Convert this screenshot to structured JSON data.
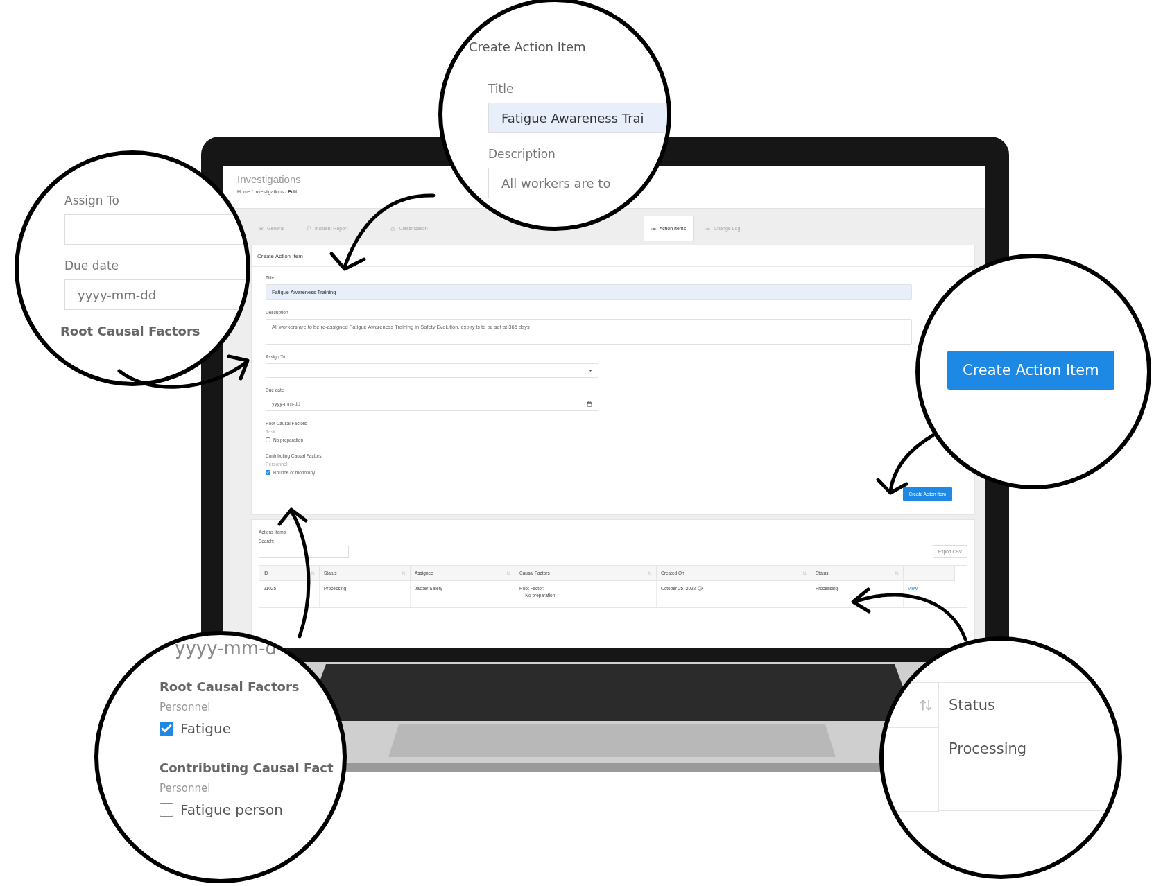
{
  "screen": {
    "title": "Investigations",
    "breadcrumb": "Home / Investigations / **Edit**",
    "tabs": [
      {
        "label": "General",
        "selected": false
      },
      {
        "label": "Incident Report",
        "selected": false
      },
      {
        "label": "Classification",
        "selected": false
      },
      {
        "label": "Action Items",
        "selected": true
      },
      {
        "label": "Change Log",
        "selected": false
      }
    ],
    "form": {
      "heading": "Create Action Item",
      "title_label": "Title",
      "title_value": "Fatigue Awareness Training",
      "description_label": "Description",
      "description_value": "All workers are to be re-assigned Fatigue Awareness Training in Safety Evolution, expiry is to be set at 365 days",
      "assign_label": "Assign To",
      "due_label": "Due date",
      "due_placeholder": "yyyy-mm-dd",
      "factor_groups": [
        {
          "title": "Root Causal Factors",
          "subtitle": "Task",
          "option": {
            "label": "No preparation",
            "checked": false
          }
        },
        {
          "title": "Contributing Causal Factors",
          "subtitle": "Personnel",
          "option": {
            "label": "Routine or monotony",
            "checked": true
          }
        }
      ],
      "submit": "Create Action Item"
    },
    "actions": {
      "heading": "Actions Items",
      "search_label": "Search:",
      "export": "Export CSV",
      "columns": [
        "ID",
        "Status",
        "Assignee",
        "Causal Factors",
        "Created On",
        "Status"
      ],
      "rows": [
        {
          "id": "21025",
          "status": "Processing",
          "assignee": "Jasper Safety",
          "causal_title": "Root Factor:",
          "causal_item": "— No preparation",
          "created": "October 25, 2022",
          "status_2": "Processing",
          "action": "View"
        }
      ]
    }
  },
  "callouts": [
    {
      "kind": "title_form",
      "heading": "Create Action Item",
      "title_label": "Title",
      "title_value": "Fatigue Awareness Trai",
      "description_label": "Description",
      "description_value": "All workers are to"
    },
    {
      "kind": "assign_form",
      "assign_label": "Assign To",
      "due_label": "Due date",
      "due_placeholder": "yyyy-mm-dd",
      "root_label": "Root Causal Factors"
    },
    {
      "kind": "button",
      "label": "Create Action Item"
    },
    {
      "kind": "factors",
      "date_placeholder": "yyyy-mm-d",
      "groups": [
        {
          "title": "Root Causal Factors",
          "subtitle": "Personnel",
          "option": {
            "label": "Fatigue",
            "checked": true
          }
        },
        {
          "title": "Contributing Causal Fact",
          "subtitle": "Personnel",
          "option": {
            "label": "Fatigue person",
            "checked": false
          }
        }
      ]
    },
    {
      "kind": "column",
      "header": "Status",
      "value": "Processing"
    }
  ]
}
